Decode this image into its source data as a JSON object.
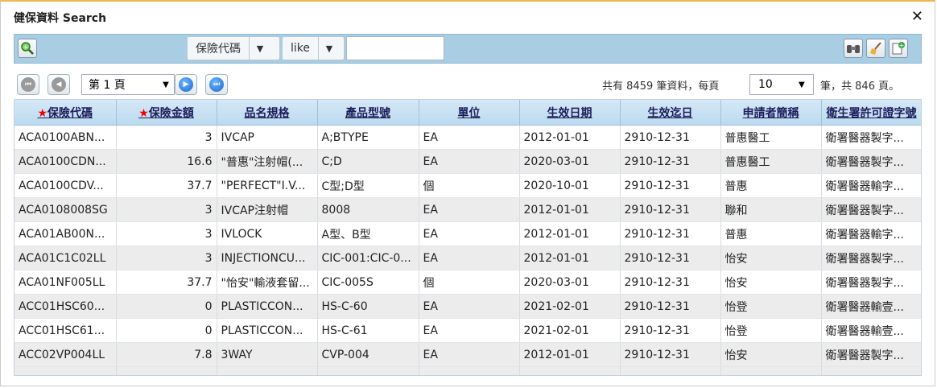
{
  "window": {
    "title": "健保資料 Search",
    "close_label": "✕"
  },
  "toolbar": {
    "field_select": "保險代碼",
    "operator_select": "like",
    "search_value": ""
  },
  "pager": {
    "current_page": "第 1 頁",
    "total_prefix": "共有",
    "total_records": "8459",
    "total_mid": "筆資料，每頁",
    "per_page": "10",
    "pages_mid": "筆，共",
    "total_pages": "846",
    "pages_suffix": "頁。"
  },
  "table": {
    "columns": [
      "保險代碼",
      "保險金額",
      "品名規格",
      "產品型號",
      "單位",
      "生效日期",
      "生效迄日",
      "申請者簡稱",
      "衛生署許可證字號"
    ],
    "rows": [
      [
        "ACA0100ABN...",
        "3",
        "IVCAP",
        "A;BTYPE",
        "EA",
        "2012-01-01",
        "2910-12-31",
        "普惠醫工",
        "衛署醫器製字..."
      ],
      [
        "ACA0100CDN...",
        "16.6",
        "\"普惠\"注射帽(...",
        "C;D",
        "EA",
        "2020-03-01",
        "2910-12-31",
        "普惠醫工",
        "衛署醫器製字..."
      ],
      [
        "ACA0100CDV...",
        "37.7",
        "\"PERFECT\"I.V...",
        "C型;D型",
        "個",
        "2020-10-01",
        "2910-12-31",
        "普惠",
        "衛署醫器輸字..."
      ],
      [
        "ACA0108008SG",
        "3",
        "IVCAP注射帽",
        "8008",
        "EA",
        "2012-01-01",
        "2910-12-31",
        "聯和",
        "衛署醫器製字..."
      ],
      [
        "ACA01AB00N...",
        "3",
        "IVLOCK",
        "A型、B型",
        "EA",
        "2012-01-01",
        "2910-12-31",
        "普惠",
        "衛署醫器輸字..."
      ],
      [
        "ACA01C1C02LL",
        "3",
        "INJECTIONCU...",
        "CIC-001:CIC-0...",
        "EA",
        "2012-01-01",
        "2910-12-31",
        "怡安",
        "衛署醫器製字..."
      ],
      [
        "ACA01NF005LL",
        "37.7",
        "\"怡安\"輸液套留...",
        "CIC-005S",
        "個",
        "2020-03-01",
        "2910-12-31",
        "怡安",
        "衛署醫器製字..."
      ],
      [
        "ACC01HSC60...",
        "0",
        "PLASTICCON...",
        "HS-C-60",
        "EA",
        "2021-02-01",
        "2910-12-31",
        "怡登",
        "衛署醫器輸壹..."
      ],
      [
        "ACC01HSC61...",
        "0",
        "PLASTICCON...",
        "HS-C-61",
        "EA",
        "2021-02-01",
        "2910-12-31",
        "怡登",
        "衛署醫器輸壹..."
      ],
      [
        "ACC02VP004LL",
        "7.8",
        "3WAY",
        "CVP-004",
        "EA",
        "2012-01-01",
        "2910-12-31",
        "怡安",
        "衛署醫器製字..."
      ]
    ]
  }
}
